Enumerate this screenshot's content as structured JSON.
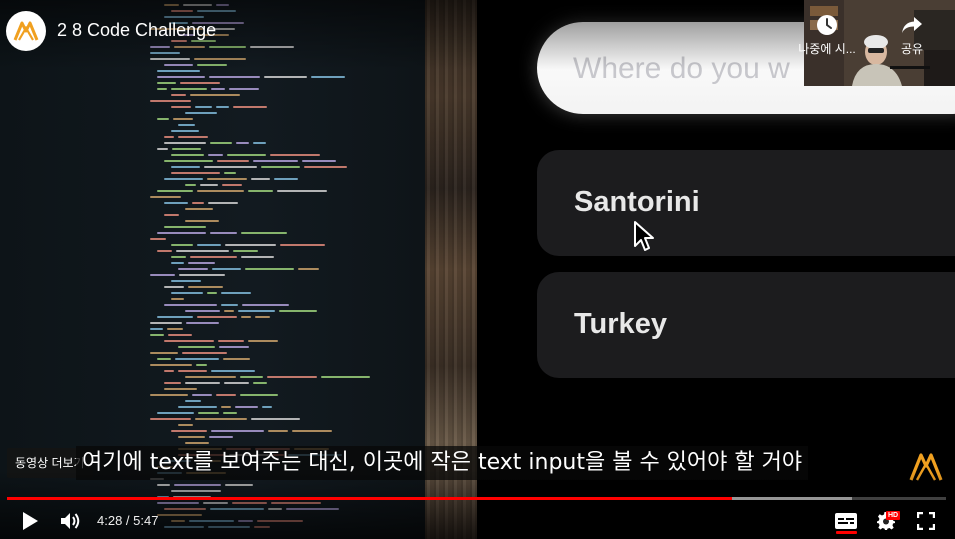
{
  "video": {
    "title": "2 8 Code Challenge",
    "current_time": "4:28",
    "duration": "5:47",
    "time_display": "4:28 / 5:47",
    "played_fraction": 0.7723,
    "buffered_fraction": 0.9
  },
  "top_actions": {
    "watch_later_label": "나중에 시...",
    "share_label": "공유"
  },
  "overlay": {
    "more_videos_label": "동영상 더보기",
    "subtitle": "여기에 text를 보여주는 대신, 이곳에 작은 text input을 볼 수 있어야 할 거야"
  },
  "app": {
    "search_placeholder": "Where do you w",
    "destinations": [
      "Santorini",
      "Turkey"
    ]
  },
  "icons": {
    "channel": "channel-logo-icon",
    "watch_later": "clock-icon",
    "share": "share-arrow-icon",
    "play": "play-icon",
    "volume": "volume-icon",
    "captions": "captions-icon",
    "settings": "gear-icon",
    "fullscreen": "fullscreen-icon",
    "cursor": "mouse-pointer-icon",
    "watermark": "channel-watermark-icon"
  },
  "colors": {
    "progress": "#ff0000",
    "brand_orange": "#f0a020",
    "card_bg": "#1c1c1e"
  }
}
